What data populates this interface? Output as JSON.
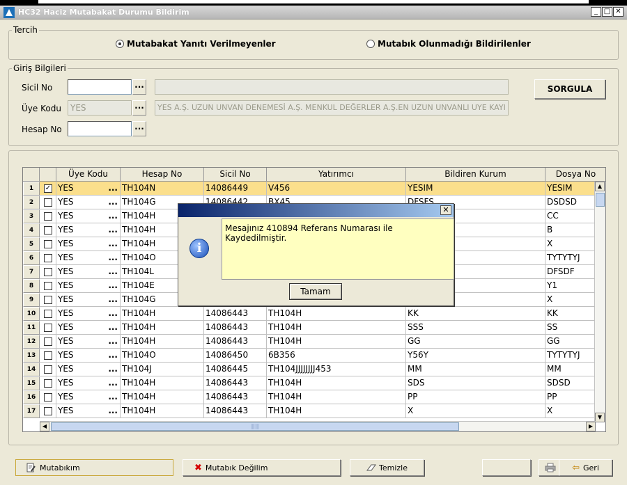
{
  "window": {
    "title": "HC32 Haciz Mutabakat Durumu Bildirim",
    "min_label": "_",
    "max_label": "□",
    "close_label": "✕"
  },
  "tercih": {
    "legend": "Tercih",
    "option1": "Mutabakat Yanıtı Verilmeyenler",
    "option2": "Mutabık Olunmadığı Bildirilenler",
    "selected": "option1"
  },
  "giris": {
    "legend": "Giriş Bilgileri",
    "sicil_label": "Sicil No",
    "sicil_value": "",
    "uye_label": "Üye Kodu",
    "uye_value": "YES",
    "uye_desc": "YES A.Ş. UZUN UNVAN DENEMESİ A.Ş. MENKUL DEĞERLER A.Ş.EN UZUN UNVANLI UYE KAYI",
    "hesap_label": "Hesap No",
    "hesap_value": "",
    "sicil_desc": "",
    "lookup_label": "...",
    "sorgula_label": "SORGULA"
  },
  "table": {
    "columns": [
      "",
      "",
      "Üye Kodu",
      "Hesap No",
      "Sicil No",
      "Yatırımcı",
      "Bildiren Kurum",
      "Dosya No"
    ],
    "rows": [
      {
        "n": "1",
        "checked": true,
        "uye": "YES",
        "hesap": "TH104N",
        "sicil": "14086449",
        "yatirimci": "V456",
        "kurum": "YESIM",
        "dosya": "YESIM"
      },
      {
        "n": "2",
        "checked": false,
        "uye": "YES",
        "hesap": "TH104G",
        "sicil": "14086442",
        "yatirimci": "BX45",
        "kurum": "DFSFS",
        "dosya": "DSDSD"
      },
      {
        "n": "3",
        "checked": false,
        "uye": "YES",
        "hesap": "TH104H",
        "sicil": "",
        "yatirimci": "",
        "kurum": "",
        "dosya": "CC"
      },
      {
        "n": "4",
        "checked": false,
        "uye": "YES",
        "hesap": "TH104H",
        "sicil": "",
        "yatirimci": "",
        "kurum": "",
        "dosya": "B"
      },
      {
        "n": "5",
        "checked": false,
        "uye": "YES",
        "hesap": "TH104H",
        "sicil": "",
        "yatirimci": "",
        "kurum": "",
        "dosya": "X"
      },
      {
        "n": "6",
        "checked": false,
        "uye": "YES",
        "hesap": "TH104O",
        "sicil": "",
        "yatirimci": "",
        "kurum": "",
        "dosya": "TYTYTYJ"
      },
      {
        "n": "7",
        "checked": false,
        "uye": "YES",
        "hesap": "TH104L",
        "sicil": "",
        "yatirimci": "",
        "kurum": "",
        "dosya": "DFSDF"
      },
      {
        "n": "8",
        "checked": false,
        "uye": "YES",
        "hesap": "TH104E",
        "sicil": "",
        "yatirimci": "",
        "kurum": "",
        "dosya": "Y1"
      },
      {
        "n": "9",
        "checked": false,
        "uye": "YES",
        "hesap": "TH104G",
        "sicil": "",
        "yatirimci": "",
        "kurum": "",
        "dosya": "X"
      },
      {
        "n": "10",
        "checked": false,
        "uye": "YES",
        "hesap": "TH104H",
        "sicil": "14086443",
        "yatirimci": "TH104H",
        "kurum": "KK",
        "dosya": "KK"
      },
      {
        "n": "11",
        "checked": false,
        "uye": "YES",
        "hesap": "TH104H",
        "sicil": "14086443",
        "yatirimci": "TH104H",
        "kurum": "SSS",
        "dosya": "SS"
      },
      {
        "n": "12",
        "checked": false,
        "uye": "YES",
        "hesap": "TH104H",
        "sicil": "14086443",
        "yatirimci": "TH104H",
        "kurum": "GG",
        "dosya": "GG"
      },
      {
        "n": "13",
        "checked": false,
        "uye": "YES",
        "hesap": "TH104O",
        "sicil": "14086450",
        "yatirimci": "6B356",
        "kurum": "Y56Y",
        "dosya": "TYTYTYJ"
      },
      {
        "n": "14",
        "checked": false,
        "uye": "YES",
        "hesap": "TH104J",
        "sicil": "14086445",
        "yatirimci": "TH104JJJJJJJJ453",
        "kurum": "MM",
        "dosya": "MM"
      },
      {
        "n": "15",
        "checked": false,
        "uye": "YES",
        "hesap": "TH104H",
        "sicil": "14086443",
        "yatirimci": "TH104H",
        "kurum": "SDS",
        "dosya": "SDSD"
      },
      {
        "n": "16",
        "checked": false,
        "uye": "YES",
        "hesap": "TH104H",
        "sicil": "14086443",
        "yatirimci": "TH104H",
        "kurum": "PP",
        "dosya": "PP"
      },
      {
        "n": "17",
        "checked": false,
        "uye": "YES",
        "hesap": "TH104H",
        "sicil": "14086443",
        "yatirimci": "TH104H",
        "kurum": "X",
        "dosya": "X"
      }
    ]
  },
  "dialog": {
    "message": "Mesajınız 410894 Referans Numarası ile Kaydedilmiştir.",
    "ok_label": "Tamam",
    "close_label": "✕",
    "icon": "info-icon"
  },
  "footer": {
    "mutabikim": "Mutabıkım",
    "mutabik_degilim": "Mutabık Değilim",
    "temizle": "Temizle",
    "geri": "Geri"
  },
  "colors": {
    "selected_row": "#fbdf8c",
    "dialog_title_start": "#0a246a",
    "message_bg": "#ffffc0"
  }
}
